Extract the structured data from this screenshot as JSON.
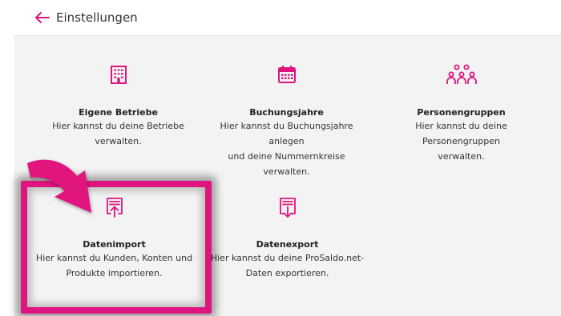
{
  "header": {
    "back_label": "Einstellungen"
  },
  "tiles": [
    {
      "icon": "building-icon",
      "title": "Eigene Betriebe",
      "desc1": "Hier kannst du deine Betriebe",
      "desc2": "verwalten."
    },
    {
      "icon": "calendar-icon",
      "title": "Buchungsjahre",
      "desc1": "Hier kannst du Buchungsjahre anlegen",
      "desc2": "und deine Nummernkreise verwalten."
    },
    {
      "icon": "people-group-icon",
      "title": "Personengruppen",
      "desc1": "Hier kannst du deine Personengruppen",
      "desc2": "verwalten."
    },
    {
      "icon": "import-icon",
      "title": "Datenimport",
      "desc1": "Hier kannst du Kunden, Konten und",
      "desc2": "Produkte importieren."
    },
    {
      "icon": "export-icon",
      "title": "Datenexport",
      "desc1": "Hier kannst du deine ProSaldo.net-",
      "desc2": "Daten exportieren."
    }
  ],
  "colors": {
    "accent": "#e0147e",
    "background": "#f3f3f3"
  }
}
